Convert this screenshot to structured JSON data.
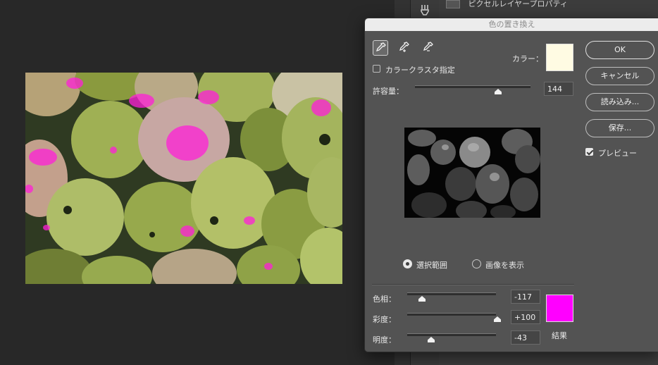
{
  "background": {
    "panel_top_label": "ピクセルレイヤープロパティ"
  },
  "dialog": {
    "title": "色の置き換え",
    "color_label": "カラー：",
    "color_swatch": "#fffbe3",
    "localized_color_clusters_label": "カラークラスタ指定",
    "localized_color_clusters_checked": false,
    "fuzziness_label": "許容量：",
    "fuzziness_value": "144",
    "fuzziness_max": 200,
    "view_selection_label": "選択範囲",
    "view_image_label": "画像を表示",
    "view_mode": "selection",
    "hue_label": "色相：",
    "hue_value": "-117",
    "saturation_label": "彩度：",
    "saturation_value": "+100",
    "lightness_label": "明度：",
    "lightness_value": "-43",
    "result_label": "結果",
    "result_swatch": "#ff00ff",
    "buttons": {
      "ok": "OK",
      "cancel": "キャンセル",
      "load": "読み込み...",
      "save": "保存..."
    },
    "preview_label": "プレビュー",
    "preview_checked": true
  },
  "icons": {
    "eyedropper": "eyedropper-icon",
    "eyedropper_plus": "eyedropper-plus-icon",
    "eyedropper_minus": "eyedropper-minus-icon",
    "panel_tool": "brush-settings-icon"
  }
}
